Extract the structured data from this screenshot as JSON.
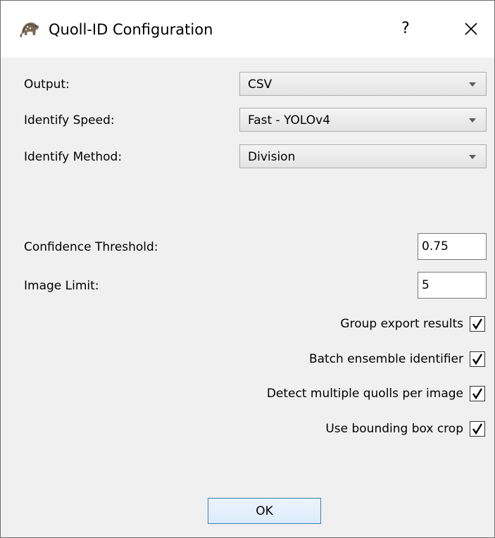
{
  "window": {
    "title": "Quoll-ID Configuration",
    "help_label": "?",
    "close_label": "✕"
  },
  "fields": {
    "output": {
      "label": "Output:",
      "value": "CSV"
    },
    "identify_speed": {
      "label": "Identify Speed:",
      "value": "Fast - YOLOv4"
    },
    "identify_method": {
      "label": "Identify Method:",
      "value": "Division"
    },
    "confidence_threshold": {
      "label": "Confidence Threshold:",
      "value": "0.75"
    },
    "image_limit": {
      "label": "Image Limit:",
      "value": "5"
    }
  },
  "checkboxes": [
    {
      "label": "Group export results",
      "checked": true
    },
    {
      "label": "Batch ensemble identifier",
      "checked": true
    },
    {
      "label": "Detect multiple quolls per image",
      "checked": true
    },
    {
      "label": "Use bounding box crop",
      "checked": true
    }
  ],
  "buttons": {
    "ok_label": "OK"
  },
  "colors": {
    "ok_border": "#3c7fb1",
    "window_bg": "#f0f0f0"
  }
}
